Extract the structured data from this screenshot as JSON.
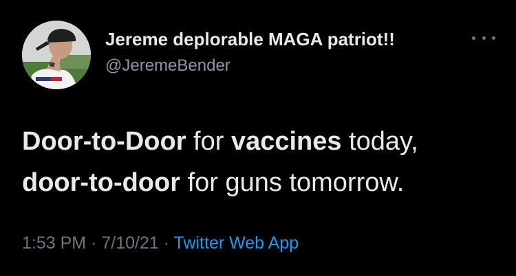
{
  "author": {
    "display_name": "Jereme deplorable MAGA patriot!!",
    "handle": "@JeremeBender"
  },
  "more_icon": "more-horizontal-icon",
  "tweet": {
    "segments": [
      {
        "text": "Door-to-Door",
        "bold": true
      },
      {
        "text": " for ",
        "bold": false
      },
      {
        "text": "vaccines",
        "bold": true
      },
      {
        "text": " today,",
        "bold": false
      },
      {
        "text": "door-to-door",
        "bold": true
      },
      {
        "text": " for guns tomorrow.",
        "bold": false
      }
    ]
  },
  "meta": {
    "time": "1:53 PM",
    "separator": "·",
    "date": "7/10/21",
    "source": "Twitter Web App"
  },
  "colors": {
    "background": "#000000",
    "text": "#e7e9ea",
    "secondary": "#8b98a5",
    "link": "#1d9bf0"
  }
}
